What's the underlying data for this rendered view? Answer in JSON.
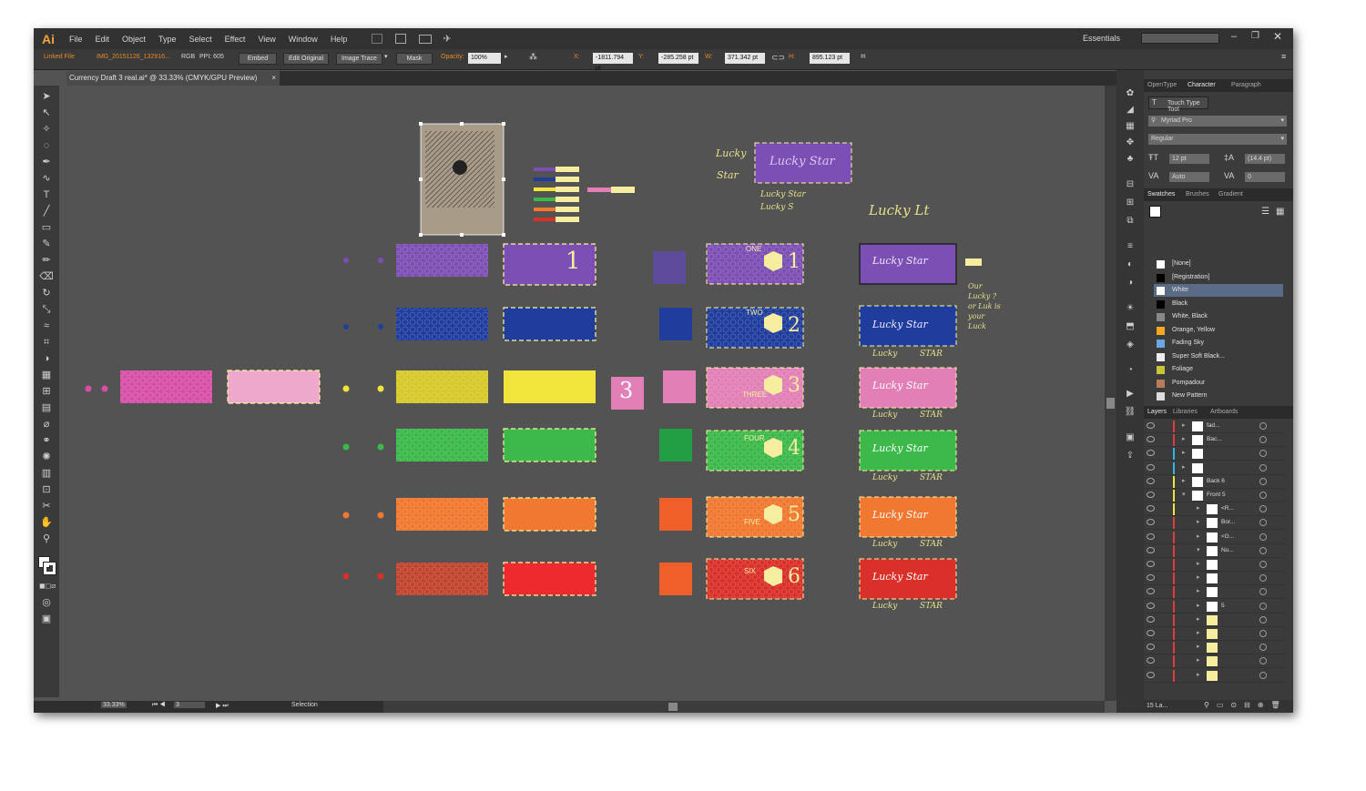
{
  "app": {
    "logo": "Ai",
    "workspace": "Essentials"
  },
  "menu": [
    "File",
    "Edit",
    "Object",
    "Type",
    "Select",
    "Effect",
    "View",
    "Window",
    "Help"
  ],
  "control_bar": {
    "linked_file_label": "Linked File",
    "file_name": "IMG_20151126_132916...",
    "color_mode": "RGB",
    "ppi": "PPI: 605",
    "embed_button": "Embed",
    "edit_original_button": "Edit Original",
    "image_trace_button": "Image Trace",
    "mask_button": "Mask",
    "opacity_label": "Opacity:",
    "opacity_value": "100%",
    "x_label": "X:",
    "x_value": "-1811.794 pt",
    "y_label": "Y:",
    "y_value": "-285.258 pt",
    "w_label": "W:",
    "w_value": "371.342 pt",
    "h_label": "H:",
    "h_value": "895.123 pt"
  },
  "document_tab": {
    "title": "Currency Draft 3 real.ai* @ 33.33% (CMYK/GPU Preview)",
    "close": "×"
  },
  "status_bar": {
    "zoom": "33.33%",
    "artboard": "3",
    "tool": "Selection"
  },
  "canvas": {
    "big_numbers": [
      "1",
      "2",
      "3",
      "4",
      "5",
      "6"
    ],
    "square_label": "3",
    "lucky_star_header": "Lucky Star",
    "lucky_small": "Lucky",
    "star_small": "STAR",
    "handwriting": {
      "lucky_star_1": "Lucky",
      "lucky_star_2": "Star",
      "lucky_s": "Lucky Star",
      "lucky_s2": "Lucky S",
      "lucky_lt": "Lucky Lt",
      "side_note": "Our Lucky ? or Luk is your Luck"
    },
    "bill_words": [
      "ONE",
      "TWO",
      "THREE",
      "FOUR",
      "FIVE",
      "SIX"
    ],
    "colors": {
      "purple": "#7b4fb4",
      "blue": "#1f3d9c",
      "pink": "#e27fb6",
      "yellow": "#f1e43a",
      "green": "#3db84b",
      "orange": "#f07830",
      "red": "#d9302a",
      "magenta": "#d64fa7",
      "cream": "#f6ee9e"
    }
  },
  "character_panel": {
    "tabs": [
      "OpenType",
      "Character",
      "Paragraph"
    ],
    "touch_type_tool": "Touch Type Tool",
    "font_family": "Myriad Pro",
    "font_style": "Regular",
    "font_size": "12 pt",
    "leading": "(14.4 pt)",
    "kerning": "Auto",
    "tracking": "0"
  },
  "swatches_panel": {
    "tabs": [
      "Swatches",
      "Brushes",
      "Gradient"
    ],
    "items": [
      {
        "name": "[None]",
        "color": "#ffffff"
      },
      {
        "name": "[Registration]",
        "color": "#000000"
      },
      {
        "name": "White",
        "color": "#ffffff"
      },
      {
        "name": "Black",
        "color": "#000000"
      },
      {
        "name": "White, Black",
        "color": "#888888"
      },
      {
        "name": "Orange, Yellow",
        "color": "#f5a623"
      },
      {
        "name": "Fading Sky",
        "color": "#6aa6e0"
      },
      {
        "name": "Super Soft Black...",
        "color": "#eeeeee"
      },
      {
        "name": "Foliage",
        "color": "#c9c33a"
      },
      {
        "name": "Pompadour",
        "color": "#b87c5a"
      },
      {
        "name": "New Pattern",
        "color": "#dddddd"
      },
      {
        "name": "New Pattern 2",
        "color": "#e8a030"
      }
    ]
  },
  "layers_panel": {
    "tabs": [
      "Layers",
      "Libraries",
      "Artboards"
    ],
    "rows": [
      {
        "name": "fad...",
        "bar": "#e23b3b"
      },
      {
        "name": "Bac...",
        "bar": "#e23b3b"
      },
      {
        "name": "",
        "bar": "#31b6e7"
      },
      {
        "name": "",
        "bar": "#31b6e7"
      },
      {
        "name": "Back 6",
        "bar": "#f1e43a"
      },
      {
        "name": "Front 5",
        "bar": "#f1e43a"
      },
      {
        "name": "<R...",
        "bar": "#f1e43a"
      },
      {
        "name": "Bor...",
        "bar": "#e23b3b"
      },
      {
        "name": "<G...",
        "bar": "#e23b3b"
      },
      {
        "name": "Nu...",
        "bar": "#e23b3b"
      },
      {
        "name": "",
        "bar": "#e23b3b"
      },
      {
        "name": "",
        "bar": "#e23b3b"
      },
      {
        "name": "",
        "bar": "#e23b3b"
      },
      {
        "name": "5",
        "bar": "#e23b3b"
      },
      {
        "name": "",
        "bar": "#e23b3b"
      },
      {
        "name": "",
        "bar": "#e23b3b"
      },
      {
        "name": "",
        "bar": "#e23b3b"
      },
      {
        "name": "",
        "bar": "#e23b3b"
      },
      {
        "name": "",
        "bar": "#e23b3b"
      }
    ],
    "footer_count": "15 La..."
  }
}
